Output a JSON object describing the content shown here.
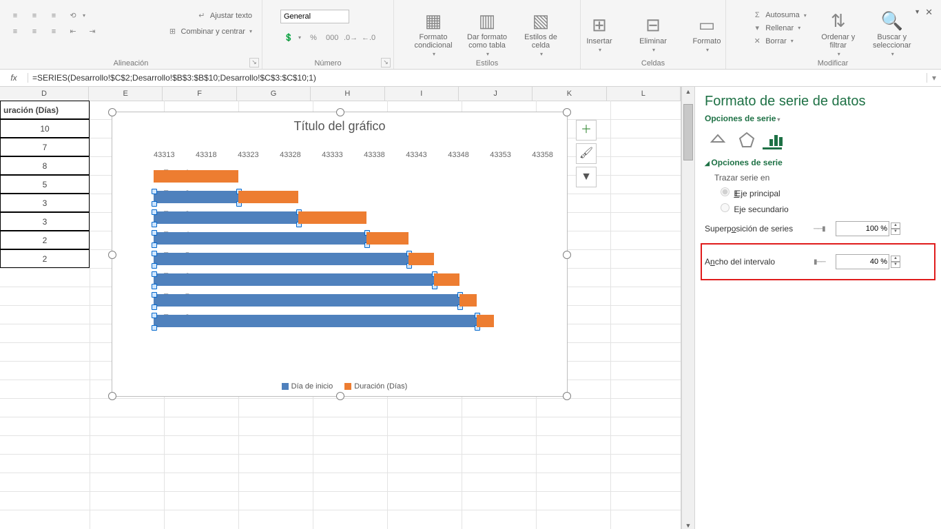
{
  "ribbon": {
    "wrap_text": "Ajustar texto",
    "merge_center": "Combinar y centrar",
    "group_align": "Alineación",
    "number_format": "General",
    "group_number": "Número",
    "cond_fmt": "Formato condicional",
    "as_table": "Dar formato como tabla",
    "cell_styles": "Estilos de celda",
    "group_styles": "Estilos",
    "insert": "Insertar",
    "delete": "Eliminar",
    "format": "Formato",
    "group_cells": "Celdas",
    "autosum": "Autosuma",
    "fill": "Rellenar",
    "clear": "Borrar",
    "sort_filter": "Ordenar y filtrar",
    "find_select": "Buscar y seleccionar",
    "group_editing": "Modificar"
  },
  "formula": "=SERIES(Desarrollo!$C$2;Desarrollo!$B$3:$B$10;Desarrollo!$C$3:$C$10;1)",
  "columns": [
    "D",
    "E",
    "F",
    "G",
    "H",
    "I",
    "J",
    "K",
    "L"
  ],
  "table_header": "uración (Días)",
  "table_values": [
    10,
    7,
    8,
    5,
    3,
    3,
    2,
    2
  ],
  "chart": {
    "title": "Título del gráfico",
    "legend_start": "Día de inicio",
    "legend_dur": "Duración (Días)"
  },
  "chart_data": {
    "type": "bar",
    "orientation": "horizontal-stacked",
    "title": "Título del gráfico",
    "x_ticks": [
      43313,
      43318,
      43323,
      43328,
      43333,
      43338,
      43343,
      43348,
      43353,
      43358
    ],
    "xlim": [
      43313,
      43360
    ],
    "categories": [
      "Tarea-1",
      "Tarea-2",
      "Tarea-3",
      "Tarea-4",
      "Tarea-5",
      "Tarea-6",
      "Tarea-7",
      "Tarea-8"
    ],
    "series": [
      {
        "name": "Día de inicio",
        "color": "#4f81bd",
        "values": [
          43313,
          43313,
          43313,
          43313,
          43313,
          43313,
          43313,
          43313
        ],
        "note": "blue segment starts at xlim[0]; drawn length = start_date - xlim[0]",
        "start_dates": [
          43313,
          43323,
          43330,
          43338,
          43343,
          43346,
          43349,
          43351
        ]
      },
      {
        "name": "Duración (Días)",
        "color": "#ed7d31",
        "values": [
          10,
          7,
          8,
          5,
          3,
          3,
          2,
          2
        ]
      }
    ],
    "legend_position": "bottom"
  },
  "pane": {
    "title": "Formato de serie de datos",
    "subtitle": "Opciones de serie",
    "section": "Opciones de serie",
    "plot_on": "Trazar serie en",
    "axis_primary": "Eje principal",
    "axis_secondary": "Eje secundario",
    "overlap_label": "Superposición de series",
    "overlap_value": "100 %",
    "gap_label": "Ancho del intervalo",
    "gap_value": "40 %"
  }
}
